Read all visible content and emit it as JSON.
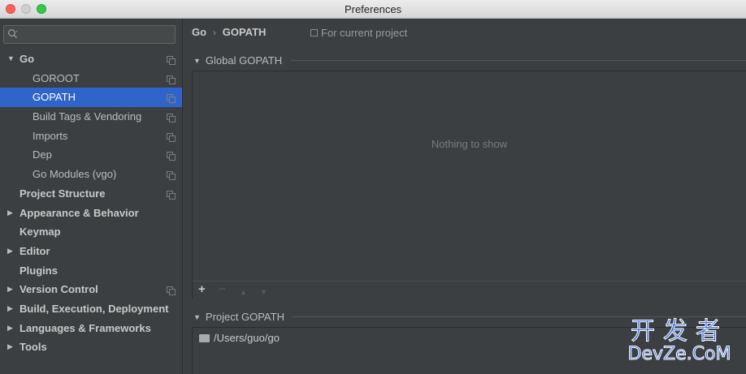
{
  "window": {
    "title": "Preferences"
  },
  "search": {
    "placeholder": ""
  },
  "sidebar": {
    "items": [
      {
        "label": "Go",
        "level": 0,
        "expanded": true,
        "bold": true,
        "copy": true,
        "selected": false
      },
      {
        "label": "GOROOT",
        "level": 1,
        "bold": false,
        "copy": true,
        "selected": false
      },
      {
        "label": "GOPATH",
        "level": 1,
        "bold": false,
        "copy": true,
        "selected": true
      },
      {
        "label": "Build Tags & Vendoring",
        "level": 1,
        "bold": false,
        "copy": true,
        "selected": false
      },
      {
        "label": "Imports",
        "level": 1,
        "bold": false,
        "copy": true,
        "selected": false
      },
      {
        "label": "Dep",
        "level": 1,
        "bold": false,
        "copy": true,
        "selected": false
      },
      {
        "label": "Go Modules (vgo)",
        "level": 1,
        "bold": false,
        "copy": true,
        "selected": false
      },
      {
        "label": "Project Structure",
        "level": 0,
        "bold": true,
        "copy": true,
        "selected": false
      },
      {
        "label": "Appearance & Behavior",
        "level": 0,
        "expanded": false,
        "bold": true,
        "copy": false,
        "selected": false
      },
      {
        "label": "Keymap",
        "level": 0,
        "bold": true,
        "copy": false,
        "selected": false
      },
      {
        "label": "Editor",
        "level": 0,
        "expanded": false,
        "bold": true,
        "copy": false,
        "selected": false
      },
      {
        "label": "Plugins",
        "level": 0,
        "bold": true,
        "copy": false,
        "selected": false
      },
      {
        "label": "Version Control",
        "level": 0,
        "expanded": false,
        "bold": true,
        "copy": true,
        "selected": false
      },
      {
        "label": "Build, Execution, Deployment",
        "level": 0,
        "expanded": false,
        "bold": true,
        "copy": false,
        "selected": false
      },
      {
        "label": "Languages & Frameworks",
        "level": 0,
        "expanded": false,
        "bold": true,
        "copy": false,
        "selected": false
      },
      {
        "label": "Tools",
        "level": 0,
        "expanded": false,
        "bold": true,
        "copy": false,
        "selected": false
      }
    ]
  },
  "header": {
    "breadcrumb": [
      "Go",
      "GOPATH"
    ],
    "scope_label": "For current project"
  },
  "global_section": {
    "title": "Global GOPATH",
    "empty_text": "Nothing to show",
    "toolbar": {
      "add": "+",
      "remove": "−",
      "up": "▲",
      "down": "▼"
    }
  },
  "project_section": {
    "title": "Project GOPATH",
    "paths": [
      "/Users/guo/go"
    ]
  },
  "watermark": {
    "line1": "开发者",
    "line2": "DevZe.CoM"
  },
  "colors": {
    "selection": "#2f65ca",
    "background": "#3c3f41",
    "watermark": "#3a6fd8"
  }
}
